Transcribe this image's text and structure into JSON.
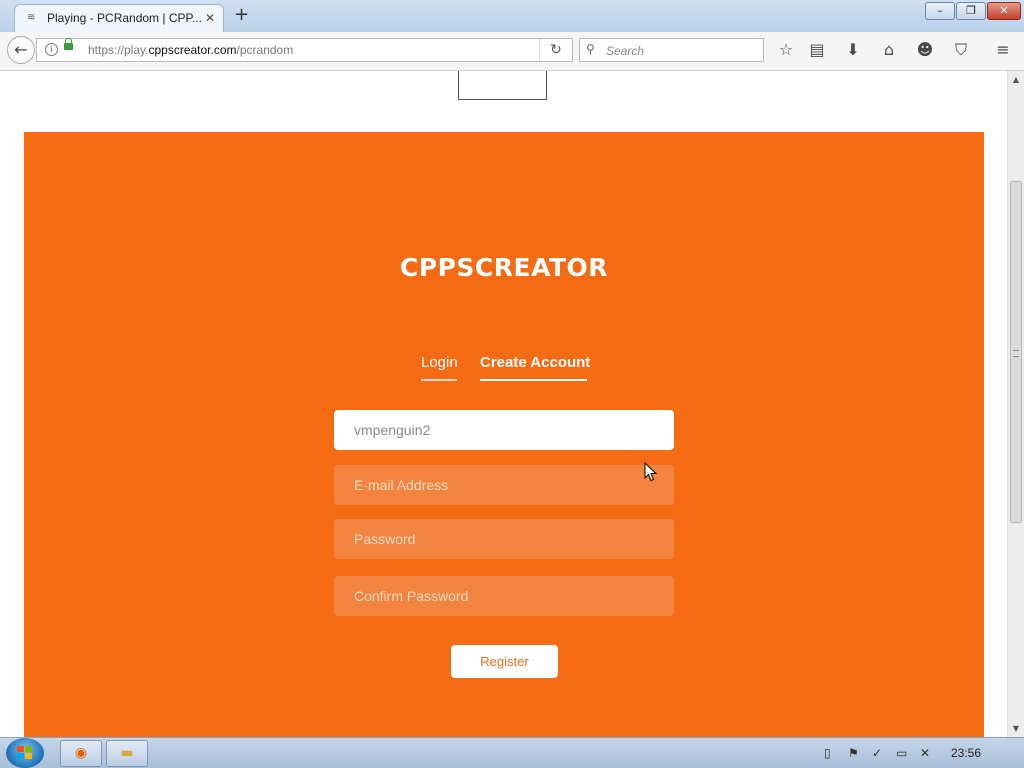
{
  "browser": {
    "tab_title": "Playing - PCRandom | CPP...",
    "tab_close": "✕",
    "new_tab": "+",
    "url_prefix": "https://play.",
    "url_domain": "cppscreator.com",
    "url_path": "/pcrandom",
    "search_placeholder": "Search",
    "window_buttons": {
      "minimize": "–",
      "maximize": "❐",
      "close": "✕"
    },
    "icons": {
      "back": "back-arrow-icon",
      "info": "info-icon",
      "lock": "lock-icon",
      "reload": "reload-icon",
      "search": "search-icon",
      "bookmark": "star-icon",
      "reading_list": "clipboard-icon",
      "downloads": "download-icon",
      "home": "home-icon",
      "hello": "smiley-icon",
      "pocket": "pocket-icon",
      "menu": "hamburger-menu-icon"
    }
  },
  "page": {
    "brand": "CPPSCREATOR",
    "tabs": {
      "login": "Login",
      "create_account": "Create Account"
    },
    "form": {
      "username_value": "vmpenguin2",
      "email_placeholder": "E-mail Address",
      "password_placeholder": "Password",
      "confirm_placeholder": "Confirm Password",
      "register_label": "Register"
    },
    "accent_color": "#f56b14"
  },
  "taskbar": {
    "clock": "23:56",
    "apps": [
      "firefox-icon",
      "folder-icon"
    ],
    "tray_icons": [
      "document-icon",
      "flag-icon",
      "network-icon",
      "monitor-icon",
      "volume-muted-icon"
    ]
  }
}
